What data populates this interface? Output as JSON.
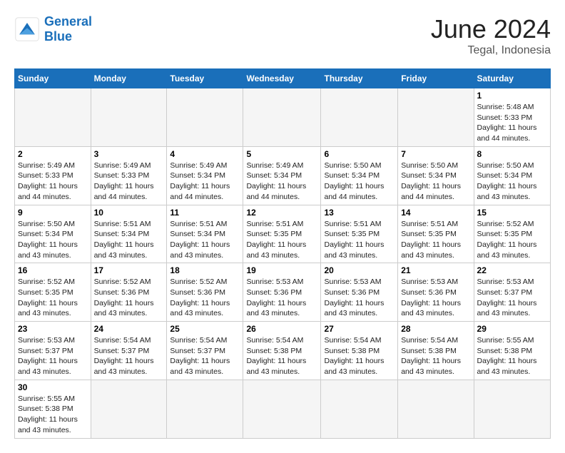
{
  "header": {
    "logo_general": "General",
    "logo_blue": "Blue",
    "month_year": "June 2024",
    "location": "Tegal, Indonesia"
  },
  "weekdays": [
    "Sunday",
    "Monday",
    "Tuesday",
    "Wednesday",
    "Thursday",
    "Friday",
    "Saturday"
  ],
  "weeks": [
    [
      {
        "day": "",
        "info": ""
      },
      {
        "day": "",
        "info": ""
      },
      {
        "day": "",
        "info": ""
      },
      {
        "day": "",
        "info": ""
      },
      {
        "day": "",
        "info": ""
      },
      {
        "day": "",
        "info": ""
      },
      {
        "day": "1",
        "info": "Sunrise: 5:48 AM\nSunset: 5:33 PM\nDaylight: 11 hours and 44 minutes."
      }
    ],
    [
      {
        "day": "2",
        "info": "Sunrise: 5:49 AM\nSunset: 5:33 PM\nDaylight: 11 hours and 44 minutes."
      },
      {
        "day": "3",
        "info": "Sunrise: 5:49 AM\nSunset: 5:33 PM\nDaylight: 11 hours and 44 minutes."
      },
      {
        "day": "4",
        "info": "Sunrise: 5:49 AM\nSunset: 5:34 PM\nDaylight: 11 hours and 44 minutes."
      },
      {
        "day": "5",
        "info": "Sunrise: 5:49 AM\nSunset: 5:34 PM\nDaylight: 11 hours and 44 minutes."
      },
      {
        "day": "6",
        "info": "Sunrise: 5:50 AM\nSunset: 5:34 PM\nDaylight: 11 hours and 44 minutes."
      },
      {
        "day": "7",
        "info": "Sunrise: 5:50 AM\nSunset: 5:34 PM\nDaylight: 11 hours and 44 minutes."
      },
      {
        "day": "8",
        "info": "Sunrise: 5:50 AM\nSunset: 5:34 PM\nDaylight: 11 hours and 43 minutes."
      }
    ],
    [
      {
        "day": "9",
        "info": "Sunrise: 5:50 AM\nSunset: 5:34 PM\nDaylight: 11 hours and 43 minutes."
      },
      {
        "day": "10",
        "info": "Sunrise: 5:51 AM\nSunset: 5:34 PM\nDaylight: 11 hours and 43 minutes."
      },
      {
        "day": "11",
        "info": "Sunrise: 5:51 AM\nSunset: 5:34 PM\nDaylight: 11 hours and 43 minutes."
      },
      {
        "day": "12",
        "info": "Sunrise: 5:51 AM\nSunset: 5:35 PM\nDaylight: 11 hours and 43 minutes."
      },
      {
        "day": "13",
        "info": "Sunrise: 5:51 AM\nSunset: 5:35 PM\nDaylight: 11 hours and 43 minutes."
      },
      {
        "day": "14",
        "info": "Sunrise: 5:51 AM\nSunset: 5:35 PM\nDaylight: 11 hours and 43 minutes."
      },
      {
        "day": "15",
        "info": "Sunrise: 5:52 AM\nSunset: 5:35 PM\nDaylight: 11 hours and 43 minutes."
      }
    ],
    [
      {
        "day": "16",
        "info": "Sunrise: 5:52 AM\nSunset: 5:35 PM\nDaylight: 11 hours and 43 minutes."
      },
      {
        "day": "17",
        "info": "Sunrise: 5:52 AM\nSunset: 5:36 PM\nDaylight: 11 hours and 43 minutes."
      },
      {
        "day": "18",
        "info": "Sunrise: 5:52 AM\nSunset: 5:36 PM\nDaylight: 11 hours and 43 minutes."
      },
      {
        "day": "19",
        "info": "Sunrise: 5:53 AM\nSunset: 5:36 PM\nDaylight: 11 hours and 43 minutes."
      },
      {
        "day": "20",
        "info": "Sunrise: 5:53 AM\nSunset: 5:36 PM\nDaylight: 11 hours and 43 minutes."
      },
      {
        "day": "21",
        "info": "Sunrise: 5:53 AM\nSunset: 5:36 PM\nDaylight: 11 hours and 43 minutes."
      },
      {
        "day": "22",
        "info": "Sunrise: 5:53 AM\nSunset: 5:37 PM\nDaylight: 11 hours and 43 minutes."
      }
    ],
    [
      {
        "day": "23",
        "info": "Sunrise: 5:53 AM\nSunset: 5:37 PM\nDaylight: 11 hours and 43 minutes."
      },
      {
        "day": "24",
        "info": "Sunrise: 5:54 AM\nSunset: 5:37 PM\nDaylight: 11 hours and 43 minutes."
      },
      {
        "day": "25",
        "info": "Sunrise: 5:54 AM\nSunset: 5:37 PM\nDaylight: 11 hours and 43 minutes."
      },
      {
        "day": "26",
        "info": "Sunrise: 5:54 AM\nSunset: 5:38 PM\nDaylight: 11 hours and 43 minutes."
      },
      {
        "day": "27",
        "info": "Sunrise: 5:54 AM\nSunset: 5:38 PM\nDaylight: 11 hours and 43 minutes."
      },
      {
        "day": "28",
        "info": "Sunrise: 5:54 AM\nSunset: 5:38 PM\nDaylight: 11 hours and 43 minutes."
      },
      {
        "day": "29",
        "info": "Sunrise: 5:55 AM\nSunset: 5:38 PM\nDaylight: 11 hours and 43 minutes."
      }
    ],
    [
      {
        "day": "30",
        "info": "Sunrise: 5:55 AM\nSunset: 5:38 PM\nDaylight: 11 hours and 43 minutes."
      },
      {
        "day": "",
        "info": ""
      },
      {
        "day": "",
        "info": ""
      },
      {
        "day": "",
        "info": ""
      },
      {
        "day": "",
        "info": ""
      },
      {
        "day": "",
        "info": ""
      },
      {
        "day": "",
        "info": ""
      }
    ]
  ]
}
